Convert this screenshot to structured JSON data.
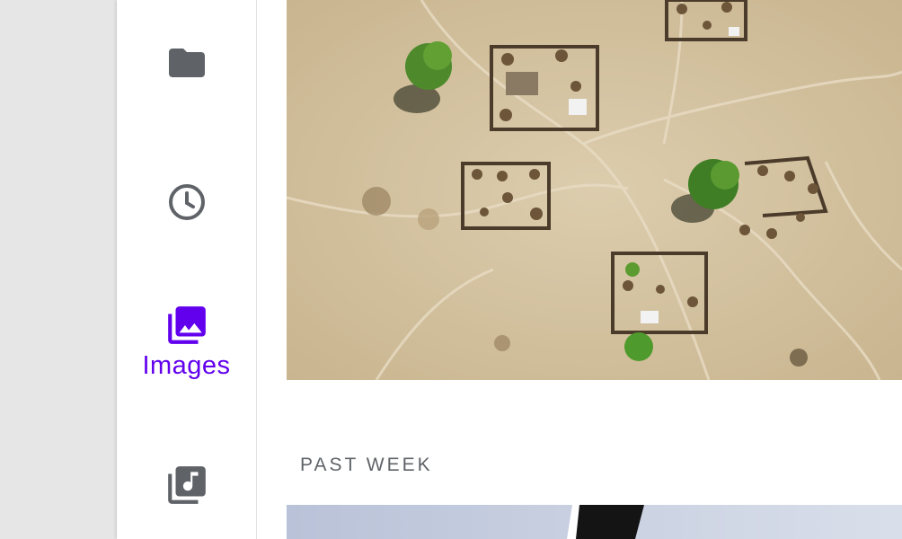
{
  "nav": {
    "items": [
      {
        "id": "files",
        "icon": "folder-icon",
        "label": "",
        "active": false
      },
      {
        "id": "recent",
        "icon": "clock-icon",
        "label": "",
        "active": false
      },
      {
        "id": "images",
        "icon": "image-library-icon",
        "label": "Images",
        "active": true
      },
      {
        "id": "audio",
        "icon": "music-library-icon",
        "label": "",
        "active": false
      }
    ]
  },
  "sections": {
    "past_week_label": "PAST WEEK"
  },
  "colors": {
    "accent": "#6200ee",
    "icon_inactive": "#5f6368",
    "background": "#ffffff",
    "outer_background": "#e6e6e6"
  }
}
